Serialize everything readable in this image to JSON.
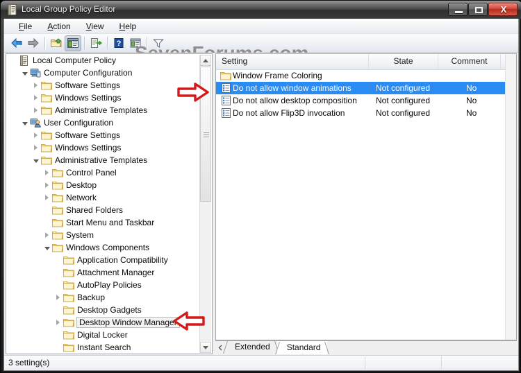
{
  "window": {
    "title": "Local Group Policy Editor",
    "icon": "policy-document-icon",
    "controls": {
      "minimize": "–",
      "maximize": "□",
      "close": "X"
    }
  },
  "watermark": {
    "text": "SevenForums.com",
    "color": "#8e8e8e"
  },
  "menu": {
    "items": [
      {
        "label": "File",
        "accesskey": "F"
      },
      {
        "label": "Action",
        "accesskey": "A"
      },
      {
        "label": "View",
        "accesskey": "V"
      },
      {
        "label": "Help",
        "accesskey": "H"
      }
    ]
  },
  "toolbar": {
    "buttons": [
      {
        "name": "back-button",
        "icon": "arrow-left-icon",
        "enabled": true,
        "pressed": false
      },
      {
        "name": "forward-button",
        "icon": "arrow-right-icon",
        "enabled": false,
        "pressed": false
      },
      {
        "name": "up-one-level-button",
        "icon": "folder-up-icon",
        "enabled": true,
        "pressed": false
      },
      {
        "name": "show-hide-tree-button",
        "icon": "show-tree-icon",
        "enabled": true,
        "pressed": true
      },
      {
        "name": "export-list-button",
        "icon": "export-list-icon",
        "enabled": true,
        "pressed": false
      },
      {
        "name": "help-button",
        "icon": "question-mark-icon",
        "enabled": true,
        "pressed": false
      },
      {
        "name": "properties-button",
        "icon": "properties-icon",
        "enabled": true,
        "pressed": false
      },
      {
        "name": "filter-button",
        "icon": "funnel-filter-icon",
        "enabled": true,
        "pressed": false
      }
    ]
  },
  "tree": {
    "nodes": [
      {
        "label": "Local Computer Policy",
        "depth": 0,
        "expander": "none",
        "icon": "policy-document-icon",
        "selected": false
      },
      {
        "label": "Computer Configuration",
        "depth": 1,
        "expander": "open",
        "icon": "computer-icon",
        "selected": false
      },
      {
        "label": "Software Settings",
        "depth": 2,
        "expander": "closed",
        "icon": "folder-icon",
        "selected": false
      },
      {
        "label": "Windows Settings",
        "depth": 2,
        "expander": "closed",
        "icon": "folder-icon",
        "selected": false
      },
      {
        "label": "Administrative Templates",
        "depth": 2,
        "expander": "closed",
        "icon": "folder-icon",
        "selected": false
      },
      {
        "label": "User Configuration",
        "depth": 1,
        "expander": "open",
        "icon": "user-icon",
        "selected": false
      },
      {
        "label": "Software Settings",
        "depth": 2,
        "expander": "closed",
        "icon": "folder-icon",
        "selected": false
      },
      {
        "label": "Windows Settings",
        "depth": 2,
        "expander": "closed",
        "icon": "folder-icon",
        "selected": false
      },
      {
        "label": "Administrative Templates",
        "depth": 2,
        "expander": "open",
        "icon": "folder-icon",
        "selected": false
      },
      {
        "label": "Control Panel",
        "depth": 3,
        "expander": "closed",
        "icon": "folder-icon",
        "selected": false
      },
      {
        "label": "Desktop",
        "depth": 3,
        "expander": "closed",
        "icon": "folder-icon",
        "selected": false
      },
      {
        "label": "Network",
        "depth": 3,
        "expander": "closed",
        "icon": "folder-icon",
        "selected": false
      },
      {
        "label": "Shared Folders",
        "depth": 3,
        "expander": "none",
        "icon": "folder-icon",
        "selected": false
      },
      {
        "label": "Start Menu and Taskbar",
        "depth": 3,
        "expander": "none",
        "icon": "folder-icon",
        "selected": false
      },
      {
        "label": "System",
        "depth": 3,
        "expander": "closed",
        "icon": "folder-icon",
        "selected": false
      },
      {
        "label": "Windows Components",
        "depth": 3,
        "expander": "open",
        "icon": "folder-icon",
        "selected": false
      },
      {
        "label": "Application Compatibility",
        "depth": 4,
        "expander": "none",
        "icon": "folder-icon",
        "selected": false
      },
      {
        "label": "Attachment Manager",
        "depth": 4,
        "expander": "none",
        "icon": "folder-icon",
        "selected": false
      },
      {
        "label": "AutoPlay Policies",
        "depth": 4,
        "expander": "none",
        "icon": "folder-icon",
        "selected": false
      },
      {
        "label": "Backup",
        "depth": 4,
        "expander": "closed",
        "icon": "folder-icon",
        "selected": false
      },
      {
        "label": "Desktop Gadgets",
        "depth": 4,
        "expander": "none",
        "icon": "folder-icon",
        "selected": false
      },
      {
        "label": "Desktop Window Manager",
        "depth": 4,
        "expander": "closed",
        "icon": "folder-icon",
        "selected": true
      },
      {
        "label": "Digital Locker",
        "depth": 4,
        "expander": "none",
        "icon": "folder-icon",
        "selected": false
      },
      {
        "label": "Instant Search",
        "depth": 4,
        "expander": "none",
        "icon": "folder-icon",
        "selected": false
      }
    ]
  },
  "list": {
    "columns": [
      {
        "label": "Setting"
      },
      {
        "label": "State"
      },
      {
        "label": "Comment"
      }
    ],
    "rows": [
      {
        "name": "Window Frame Coloring",
        "state": "",
        "comment": "",
        "icon": "folder-icon",
        "selected": false
      },
      {
        "name": "Do not allow window animations",
        "state": "Not configured",
        "comment": "No",
        "icon": "policy-setting-icon",
        "selected": true
      },
      {
        "name": "Do not allow desktop composition",
        "state": "Not configured",
        "comment": "No",
        "icon": "policy-setting-icon",
        "selected": false
      },
      {
        "name": "Do not allow Flip3D invocation",
        "state": "Not configured",
        "comment": "No",
        "icon": "policy-setting-icon",
        "selected": false
      }
    ],
    "selection_color": "#2a8bf2"
  },
  "tabs": {
    "items": [
      {
        "label": "Extended",
        "active": false
      },
      {
        "label": "Standard",
        "active": true
      }
    ]
  },
  "statusbar": {
    "text": "3 setting(s)",
    "cell2": "",
    "cell3": ""
  },
  "annotations": [
    {
      "name": "red-arrow-right",
      "direction": "right",
      "color": "#d31919",
      "target": "Do not allow window animations"
    },
    {
      "name": "red-arrow-left",
      "direction": "left",
      "color": "#d31919",
      "target": "Desktop Window Manager"
    }
  ]
}
